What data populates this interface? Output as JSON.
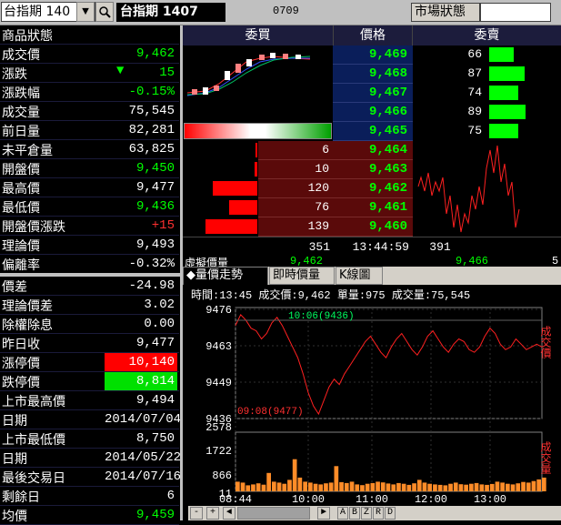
{
  "toolbar": {
    "symbol_input": "台指期 140",
    "dropdown_arrow": "▼",
    "search_icon": "search-icon",
    "title": "台指期  1407",
    "code": "0709",
    "market_status_label": "市場狀態",
    "market_status_value": ""
  },
  "quote": [
    {
      "label": "商品狀態",
      "value": "",
      "color": "white"
    },
    {
      "label": "成交價",
      "value": "9,462",
      "color": "green"
    },
    {
      "label": "漲跌",
      "value": "15",
      "color": "green",
      "arrow": "▼"
    },
    {
      "label": "漲跌幅",
      "value": "-0.15%",
      "color": "green"
    },
    {
      "label": "成交量",
      "value": "75,545",
      "color": "white"
    },
    {
      "label": "前日量",
      "value": "82,281",
      "color": "white"
    },
    {
      "label": "未平倉量",
      "value": "63,825",
      "color": "white"
    },
    {
      "label": "開盤價",
      "value": "9,450",
      "color": "green"
    },
    {
      "label": "最高價",
      "value": "9,477",
      "color": "white"
    },
    {
      "label": "最低價",
      "value": "9,436",
      "color": "green"
    },
    {
      "label": "開盤價漲跌",
      "value": "+15",
      "color": "red"
    },
    {
      "label": "理論價",
      "value": "9,493",
      "color": "white"
    },
    {
      "label": "偏離率",
      "value": "-0.32%",
      "color": "white"
    }
  ],
  "quote2": [
    {
      "label": "價差",
      "value": "-24.98",
      "color": "white"
    },
    {
      "label": "理論價差",
      "value": "3.02",
      "color": "white"
    },
    {
      "label": "除權除息",
      "value": "0.00",
      "color": "white"
    },
    {
      "label": "昨日收",
      "value": "9,477",
      "color": "white"
    },
    {
      "label": "漲停價",
      "value": "10,140",
      "color": "limitup"
    },
    {
      "label": "跌停價",
      "value": "8,814",
      "color": "limitdown"
    },
    {
      "label": "上市最高價",
      "value": "9,494",
      "color": "white"
    },
    {
      "label": "日期",
      "value": "2014/07/04",
      "color": "white"
    },
    {
      "label": "上市最低價",
      "value": "8,750",
      "color": "white"
    },
    {
      "label": "日期",
      "value": "2014/05/22",
      "color": "white"
    },
    {
      "label": "最後交易日",
      "value": "2014/07/16",
      "color": "white"
    },
    {
      "label": "剩餘日",
      "value": "6",
      "color": "white"
    },
    {
      "label": "均價",
      "value": "9,459",
      "color": "green"
    }
  ],
  "book": {
    "header_bid": "委買",
    "header_price": "價格",
    "header_ask": "委賣",
    "asks": [
      {
        "price": "9,469",
        "qty": "66",
        "fill": 0.38
      },
      {
        "price": "9,468",
        "qty": "87",
        "fill": 0.55
      },
      {
        "price": "9,467",
        "qty": "74",
        "fill": 0.45
      },
      {
        "price": "9,466",
        "qty": "89",
        "fill": 0.57
      },
      {
        "price": "9,465",
        "qty": "75",
        "fill": 0.46
      }
    ],
    "bids": [
      {
        "price": "9,464",
        "qty": "6",
        "fill": 0.03
      },
      {
        "price": "9,463",
        "qty": "10",
        "fill": 0.05
      },
      {
        "price": "9,462",
        "qty": "120",
        "fill": 0.72
      },
      {
        "price": "9,461",
        "qty": "76",
        "fill": 0.46
      },
      {
        "price": "9,460",
        "qty": "139",
        "fill": 0.84
      }
    ],
    "total_bid": "351",
    "time": "13:44:59",
    "total_ask": "391",
    "footer_label": "虛擬價量",
    "footer_bid": "9,462",
    "footer_ask": "9,466",
    "footer_right": "5"
  },
  "tabs": [
    "◆量價走勢",
    "即時價量",
    "K線圖"
  ],
  "chart_info": "時間:13:45 成交價:9,462 單量:975 成交量:75,545",
  "chart_data": {
    "type": "line",
    "price_ticks": [
      "9476",
      "9463",
      "9449",
      "9436"
    ],
    "volume_ticks": [
      "2578",
      "1722",
      "866",
      "11"
    ],
    "x_ticks": [
      "08:44",
      "10:00",
      "11:00",
      "12:00",
      "13:00"
    ],
    "high_annotation": "10:06(9436)",
    "low_annotation": "09:08(9477)",
    "price_label": "成交價",
    "volume_label": "成交量",
    "ylim": [
      9436,
      9476
    ],
    "price_series": [
      9470,
      9474,
      9472,
      9469,
      9468,
      9465,
      9467,
      9471,
      9473,
      9470,
      9466,
      9462,
      9458,
      9452,
      9445,
      9440,
      9437,
      9442,
      9447,
      9450,
      9448,
      9452,
      9455,
      9458,
      9461,
      9464,
      9466,
      9463,
      9460,
      9458,
      9462,
      9465,
      9467,
      9464,
      9461,
      9459,
      9462,
      9466,
      9468,
      9465,
      9462,
      9460,
      9463,
      9465,
      9464,
      9461,
      9460,
      9462,
      9466,
      9469,
      9467,
      9463,
      9461,
      9462,
      9465,
      9463,
      9461,
      9462,
      9463,
      9462
    ],
    "volume_series": [
      420,
      380,
      260,
      300,
      350,
      290,
      800,
      420,
      380,
      330,
      500,
      1400,
      600,
      420,
      380,
      330,
      300,
      350,
      380,
      1100,
      400,
      360,
      420,
      300,
      270,
      330,
      360,
      420,
      390,
      340,
      300,
      360,
      330,
      280,
      350,
      500,
      380,
      330,
      300,
      280,
      260,
      330,
      380,
      310,
      290,
      330,
      360,
      300,
      280,
      320,
      420,
      380,
      330,
      300,
      350,
      410,
      380,
      450,
      520,
      600
    ]
  },
  "scroll": {
    "zoom_minus": "-",
    "zoom_plus": "+",
    "left_arrow": "◄",
    "right_arrow": "►",
    "letters": [
      "A",
      "B",
      "Z",
      "R",
      "D"
    ]
  },
  "colors": {
    "up": "#ff0000",
    "down": "#00ff00",
    "bid_bar": "#ff0000",
    "ask_bar": "#00ff00",
    "price_bg_ask": "#0a1e5a",
    "price_bg_bid": "#5a0a0a"
  }
}
